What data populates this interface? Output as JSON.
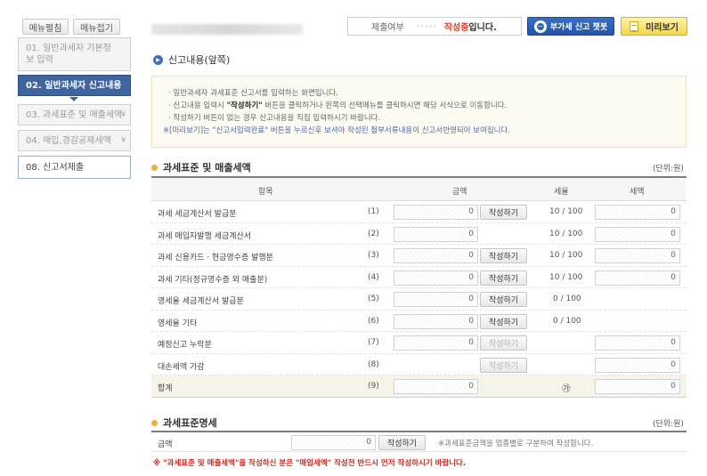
{
  "sidebar": {
    "edit_label": "메뉴펼침",
    "collapse_label": "메뉴접기",
    "items": [
      {
        "label": "01. 일반과세자 기본정보 입력"
      },
      {
        "label": "02. 일반과세자 신고내용"
      },
      {
        "label": "03. 과세표준 및 매출세액"
      },
      {
        "label": "04. 매입,경감공제세액"
      },
      {
        "label": "08. 신고서제출"
      }
    ]
  },
  "topbar": {
    "status_label": "제출여부",
    "status_arrows": "›››››",
    "status_value": "작성중",
    "status_suffix": "입니다.",
    "chat_label": "부가세 신고 챗봇",
    "preview_label": "미리보기"
  },
  "section_title": "신고내용(앞쪽)",
  "notice": {
    "line1": "일반과세자 과세표준 신고서를 입력하는 화면입니다.",
    "line2_pre": "신고내용 입력시 ",
    "line2_hl": "\"작성하기\"",
    "line2_post": " 버튼을 클릭하거나 왼쪽의 선택메뉴를 클릭하시면 해당 서식으로 이동합니다.",
    "line3": "작성하기 버튼이 없는 경우 신고내용을 직접 입력하시기 바랍니다.",
    "line4": "※[미리보기]는 \"신고서입력완료\" 버튼을 누르신후 보셔야 작성된 첨부서류내용이 신고서반영되어 보여집니다."
  },
  "tax_section": {
    "title": "과세표준 및 매출세액",
    "unit": "(단위:원)",
    "headers": {
      "item": "항목",
      "amount": "금액",
      "rate": "세율",
      "tax": "세액"
    },
    "rows": [
      {
        "label": "과세 세금계산서 발급분",
        "num": "(1)",
        "amount": "0",
        "button": "작성하기",
        "rate": "10 / 100",
        "tax": "0"
      },
      {
        "label": "과세 매입자발행 세금계산서",
        "num": "(2)",
        "amount": "0",
        "button": "",
        "rate": "10 / 100",
        "tax": "0"
      },
      {
        "label": "과세 신용카드ㆍ현금영수증 발행분",
        "num": "(3)",
        "amount": "0",
        "button": "작성하기",
        "rate": "10 / 100",
        "tax": "0"
      },
      {
        "label": "과세 기타(정규영수증 외 매출분)",
        "num": "(4)",
        "amount": "0",
        "button": "작성하기",
        "rate": "10 / 100",
        "tax": "0"
      },
      {
        "label": "영세율 세금계산서 발급분",
        "num": "(5)",
        "amount": "0",
        "button": "작성하기",
        "rate": "0 / 100",
        "tax": ""
      },
      {
        "label": "영세율 기타",
        "num": "(6)",
        "amount": "0",
        "button": "작성하기",
        "rate": "0 / 100",
        "tax": ""
      },
      {
        "label": "예정신고 누락분",
        "num": "(7)",
        "amount": "0",
        "button": "작성하기",
        "rate": "",
        "tax": "0"
      },
      {
        "label": "대손세액 가감",
        "num": "(8)",
        "amount": "",
        "button": "작성하기",
        "rate": "",
        "tax": "0"
      },
      {
        "label": "합계",
        "num": "(9)",
        "amount": "0",
        "button": "",
        "rate": "㉮",
        "tax": "0"
      }
    ]
  },
  "base_section": {
    "title": "과세표준명세",
    "unit": "(단위:원)",
    "label": "금액",
    "amount": "0",
    "button": "작성하기",
    "note": "※과세표준금액을 업종별로 구분하여 작성합니다."
  },
  "warning": "※ \"과세표준 및 매출세액\"을 작성하신 분은 \"매입세액\" 작성전 반드시 먼저 작성하시기 바랍니다."
}
